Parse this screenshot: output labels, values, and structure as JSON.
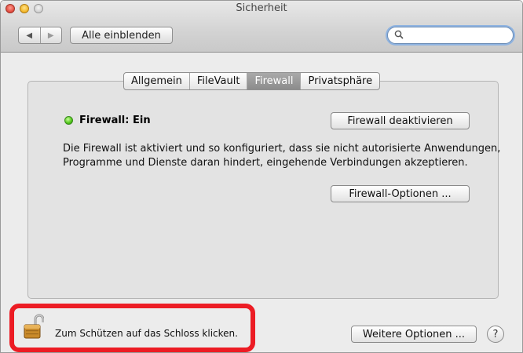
{
  "window": {
    "title": "Sicherheit"
  },
  "toolbar": {
    "back_icon": "◀",
    "forward_icon": "▶",
    "show_all_label": "Alle einblenden",
    "search_placeholder": "",
    "search_value": ""
  },
  "tabs": [
    {
      "label": "Allgemein",
      "active": false
    },
    {
      "label": "FileVault",
      "active": false
    },
    {
      "label": "Firewall",
      "active": true
    },
    {
      "label": "Privatsphäre",
      "active": false
    }
  ],
  "firewall": {
    "status_label": "Firewall: Ein",
    "status_color": "#4fc418",
    "deactivate_label": "Firewall deaktivieren",
    "description": "Die Firewall ist aktiviert und so konfiguriert, dass sie nicht autorisierte Anwendungen, Programme und Dienste daran hindert, eingehende Verbindungen akzeptieren.",
    "options_label": "Firewall-Optionen ..."
  },
  "bottom": {
    "lock_icon": "unlocked-padlock-icon",
    "lock_text": "Zum Schützen auf das Schloss klicken.",
    "more_options_label": "Weitere Optionen ...",
    "help_label": "?",
    "highlight_color": "#ec1c24"
  }
}
